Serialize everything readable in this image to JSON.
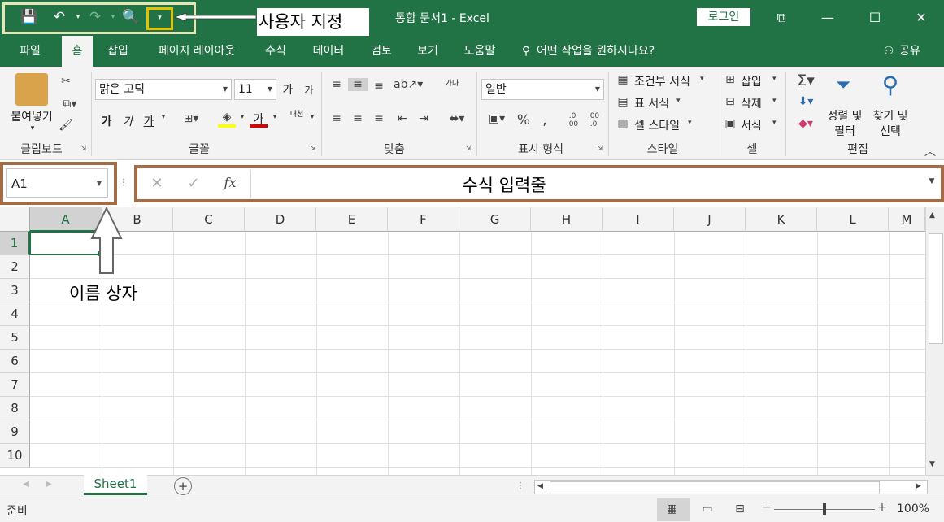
{
  "window": {
    "doc_title": "통합 문서1  -  Excel",
    "login_label": "로그인",
    "controls": [
      "⧉",
      "—",
      "☐",
      "✕"
    ]
  },
  "qat": {
    "callout_label": "사용자 지정",
    "icons": [
      "save-icon",
      "undo-icon",
      "redo-icon",
      "print-preview-icon",
      "customize-icon"
    ]
  },
  "tabs": [
    "파일",
    "홈",
    "삽입",
    "페이지 레이아웃",
    "수식",
    "데이터",
    "검토",
    "보기",
    "도움말"
  ],
  "tell_me": "어떤 작업을 원하시나요?",
  "share": "공유",
  "ribbon": {
    "clipboard": {
      "paste": "붙여넣기",
      "label": "클립보드"
    },
    "font": {
      "name": "맑은 고딕",
      "size": "11",
      "grow": "가",
      "shrink": "가",
      "bold": "가",
      "italic": "가",
      "underline": "가",
      "color_a": "가",
      "label": "글꼴",
      "phonetic": "내천"
    },
    "alignment": {
      "label": "맞춤",
      "wrap": "가나"
    },
    "number": {
      "format": "일반",
      "label": "표시 형식"
    },
    "styles": {
      "conditional": "조건부 서식",
      "table": "표 서식",
      "cell": "셀 스타일",
      "label": "스타일"
    },
    "cells": {
      "insert": "삽입",
      "delete": "삭제",
      "format": "서식",
      "label": "셀"
    },
    "editing": {
      "sort_1": "정렬 및",
      "sort_2": "필터",
      "find_1": "찾기 및",
      "find_2": "선택",
      "label": "편집"
    }
  },
  "formula_bar": {
    "name_box": "A1",
    "callout_label": "수식 입력줄",
    "fx": "fx"
  },
  "grid": {
    "columns": [
      "A",
      "B",
      "C",
      "D",
      "E",
      "F",
      "G",
      "H",
      "I",
      "J",
      "K",
      "L",
      "M"
    ],
    "rows": [
      "1",
      "2",
      "3",
      "4",
      "5",
      "6",
      "7",
      "8",
      "9",
      "10"
    ],
    "selected_cell": "A1",
    "name_box_caption": "이름 상자"
  },
  "sheets": {
    "tabs": [
      "Sheet1"
    ],
    "active": "Sheet1"
  },
  "status": {
    "text": "준비",
    "zoom": "100%"
  },
  "colors": {
    "accent": "#217346",
    "callout_border": "#a56b45",
    "qat_highlight": "#e6c100"
  }
}
